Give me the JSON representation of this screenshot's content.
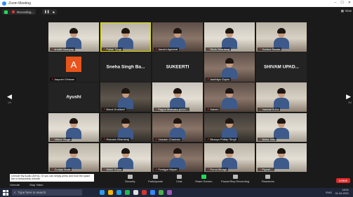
{
  "window": {
    "title": "Zoom Meeting",
    "view_label": "View"
  },
  "recording": {
    "label": "Recording..."
  },
  "participants": [
    {
      "name": "shubhi kashyap",
      "kind": "video",
      "style": "v4",
      "muted": true
    },
    {
      "name": "Pallak Tyagi",
      "kind": "video",
      "style": "v2",
      "muted": true,
      "active": true
    },
    {
      "name": "Aanshi Agarwal",
      "kind": "video",
      "style": "v3",
      "muted": true
    },
    {
      "name": "Ritvik Bhardwaj",
      "kind": "video",
      "style": "v4",
      "muted": true
    },
    {
      "name": "Garima Nanda",
      "kind": "video",
      "style": "v2",
      "muted": true
    },
    {
      "name": "Aayushi Dhiwan",
      "kind": "avatar",
      "initial": "A",
      "muted": true
    },
    {
      "name": "Sneha Singh Ba...",
      "kind": "name",
      "muted": false
    },
    {
      "name": "SUKEERTI",
      "kind": "name",
      "muted": false
    },
    {
      "name": "Aadhilya Gupta",
      "kind": "video",
      "style": "v3",
      "muted": true
    },
    {
      "name": "SHIVAM UPAD...",
      "kind": "name",
      "muted": false
    },
    {
      "name": "Ayushi",
      "kind": "name",
      "muted": false
    },
    {
      "name": "Bimal Dhaliwal",
      "kind": "video",
      "style": "v5",
      "muted": true
    },
    {
      "name": "Pagun Malhotra (2021...",
      "kind": "video",
      "style": "v4",
      "muted": true
    },
    {
      "name": "Sakshi",
      "kind": "video",
      "style": "v3",
      "muted": true
    },
    {
      "name": "Vaishali B.Ed",
      "kind": "video",
      "style": "v2",
      "muted": true
    },
    {
      "name": "Vibhor Singh",
      "kind": "video",
      "style": "v4",
      "muted": true
    },
    {
      "name": "Rishabh Bhardwaj",
      "kind": "video",
      "style": "v5",
      "muted": true
    },
    {
      "name": "Vishakh Chauhan",
      "kind": "video",
      "style": "v3",
      "muted": true
    },
    {
      "name": "Bhavya Pratap Singh",
      "kind": "video",
      "style": "v5",
      "muted": true
    },
    {
      "name": "Nikita Jain",
      "kind": "video",
      "style": "v4",
      "muted": true
    },
    {
      "name": "Gunjay Malik",
      "kind": "video",
      "style": "v2",
      "muted": true
    },
    {
      "name": "Nikhil Gupta",
      "kind": "video",
      "style": "v4",
      "muted": true
    },
    {
      "name": "Pratigya Nayan",
      "kind": "video",
      "style": "v3",
      "muted": true
    },
    {
      "name": "Purva Mudgil",
      "kind": "video",
      "style": "v2",
      "muted": true
    },
    {
      "name": "Piyush...",
      "kind": "video",
      "style": "v4",
      "muted": true
    }
  ],
  "pager": {
    "left_num": "1/4",
    "right_num": "2/4"
  },
  "toolbar": {
    "tooltip": "Unmute My Audio (Alt+A), Or you can simply press and hold the space bar to temporarily unmute",
    "unmute_label": "Unmute",
    "video_label": "Stop Video",
    "buttons": [
      "Security",
      "Participants",
      "Chat",
      "Share Screen",
      "Pause/Stop Recording",
      "Reactions"
    ],
    "leave_label": "Leave"
  },
  "taskbar": {
    "search_placeholder": "Type here to search",
    "lang": "ENG",
    "time": "18:01",
    "date": "01-04-2021",
    "app_colors": [
      "#2b9cf0",
      "#f2b705",
      "#1fa0e0",
      "#1db954",
      "#e0e0e0",
      "#d8342d",
      "#2d8cff",
      "#4caf50",
      "#9b59b6"
    ]
  }
}
